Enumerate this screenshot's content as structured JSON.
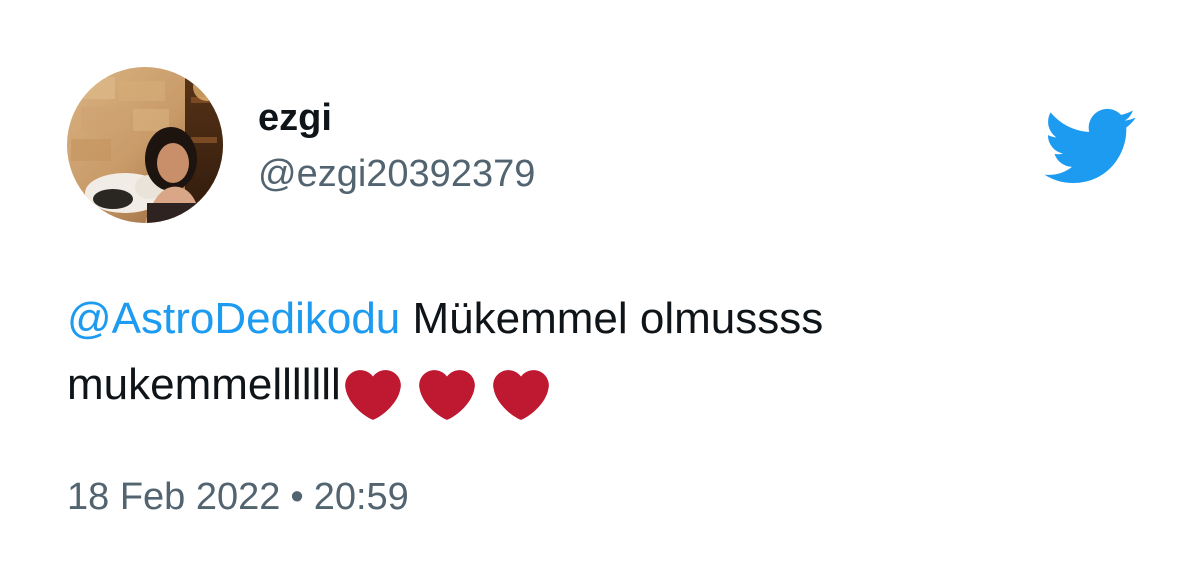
{
  "tweet": {
    "author": {
      "display_name": "ezgi",
      "handle": "@ezgi20392379"
    },
    "text": {
      "mention": "@AstroDedikodu",
      "line1_rest": " Mükemmel olmussss",
      "line2": "mukemmelllllll",
      "hearts": [
        "♥",
        "♥",
        "♥"
      ]
    },
    "date": "18 Feb 2022",
    "separator": "•",
    "time": "20:59"
  },
  "icons": {
    "logo": "twitter-bird-icon",
    "reaction": "red-heart-icon"
  },
  "colors": {
    "brand": "#1d9bf0",
    "mention": "#1d9bf0",
    "heart": "#be1931",
    "text": "#0f1419",
    "secondary_text": "#536471",
    "background": "#ffffff"
  }
}
